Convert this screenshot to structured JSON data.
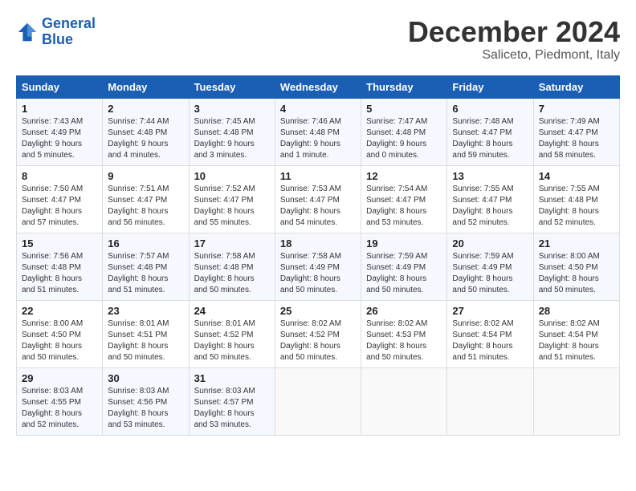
{
  "logo": {
    "line1": "General",
    "line2": "Blue"
  },
  "title": "December 2024",
  "subtitle": "Saliceto, Piedmont, Italy",
  "weekdays": [
    "Sunday",
    "Monday",
    "Tuesday",
    "Wednesday",
    "Thursday",
    "Friday",
    "Saturday"
  ],
  "weeks": [
    [
      {
        "day": "1",
        "info": "Sunrise: 7:43 AM\nSunset: 4:49 PM\nDaylight: 9 hours\nand 5 minutes."
      },
      {
        "day": "2",
        "info": "Sunrise: 7:44 AM\nSunset: 4:48 PM\nDaylight: 9 hours\nand 4 minutes."
      },
      {
        "day": "3",
        "info": "Sunrise: 7:45 AM\nSunset: 4:48 PM\nDaylight: 9 hours\nand 3 minutes."
      },
      {
        "day": "4",
        "info": "Sunrise: 7:46 AM\nSunset: 4:48 PM\nDaylight: 9 hours\nand 1 minute."
      },
      {
        "day": "5",
        "info": "Sunrise: 7:47 AM\nSunset: 4:48 PM\nDaylight: 9 hours\nand 0 minutes."
      },
      {
        "day": "6",
        "info": "Sunrise: 7:48 AM\nSunset: 4:47 PM\nDaylight: 8 hours\nand 59 minutes."
      },
      {
        "day": "7",
        "info": "Sunrise: 7:49 AM\nSunset: 4:47 PM\nDaylight: 8 hours\nand 58 minutes."
      }
    ],
    [
      {
        "day": "8",
        "info": "Sunrise: 7:50 AM\nSunset: 4:47 PM\nDaylight: 8 hours\nand 57 minutes."
      },
      {
        "day": "9",
        "info": "Sunrise: 7:51 AM\nSunset: 4:47 PM\nDaylight: 8 hours\nand 56 minutes."
      },
      {
        "day": "10",
        "info": "Sunrise: 7:52 AM\nSunset: 4:47 PM\nDaylight: 8 hours\nand 55 minutes."
      },
      {
        "day": "11",
        "info": "Sunrise: 7:53 AM\nSunset: 4:47 PM\nDaylight: 8 hours\nand 54 minutes."
      },
      {
        "day": "12",
        "info": "Sunrise: 7:54 AM\nSunset: 4:47 PM\nDaylight: 8 hours\nand 53 minutes."
      },
      {
        "day": "13",
        "info": "Sunrise: 7:55 AM\nSunset: 4:47 PM\nDaylight: 8 hours\nand 52 minutes."
      },
      {
        "day": "14",
        "info": "Sunrise: 7:55 AM\nSunset: 4:48 PM\nDaylight: 8 hours\nand 52 minutes."
      }
    ],
    [
      {
        "day": "15",
        "info": "Sunrise: 7:56 AM\nSunset: 4:48 PM\nDaylight: 8 hours\nand 51 minutes."
      },
      {
        "day": "16",
        "info": "Sunrise: 7:57 AM\nSunset: 4:48 PM\nDaylight: 8 hours\nand 51 minutes."
      },
      {
        "day": "17",
        "info": "Sunrise: 7:58 AM\nSunset: 4:48 PM\nDaylight: 8 hours\nand 50 minutes."
      },
      {
        "day": "18",
        "info": "Sunrise: 7:58 AM\nSunset: 4:49 PM\nDaylight: 8 hours\nand 50 minutes."
      },
      {
        "day": "19",
        "info": "Sunrise: 7:59 AM\nSunset: 4:49 PM\nDaylight: 8 hours\nand 50 minutes."
      },
      {
        "day": "20",
        "info": "Sunrise: 7:59 AM\nSunset: 4:49 PM\nDaylight: 8 hours\nand 50 minutes."
      },
      {
        "day": "21",
        "info": "Sunrise: 8:00 AM\nSunset: 4:50 PM\nDaylight: 8 hours\nand 50 minutes."
      }
    ],
    [
      {
        "day": "22",
        "info": "Sunrise: 8:00 AM\nSunset: 4:50 PM\nDaylight: 8 hours\nand 50 minutes."
      },
      {
        "day": "23",
        "info": "Sunrise: 8:01 AM\nSunset: 4:51 PM\nDaylight: 8 hours\nand 50 minutes."
      },
      {
        "day": "24",
        "info": "Sunrise: 8:01 AM\nSunset: 4:52 PM\nDaylight: 8 hours\nand 50 minutes."
      },
      {
        "day": "25",
        "info": "Sunrise: 8:02 AM\nSunset: 4:52 PM\nDaylight: 8 hours\nand 50 minutes."
      },
      {
        "day": "26",
        "info": "Sunrise: 8:02 AM\nSunset: 4:53 PM\nDaylight: 8 hours\nand 50 minutes."
      },
      {
        "day": "27",
        "info": "Sunrise: 8:02 AM\nSunset: 4:54 PM\nDaylight: 8 hours\nand 51 minutes."
      },
      {
        "day": "28",
        "info": "Sunrise: 8:02 AM\nSunset: 4:54 PM\nDaylight: 8 hours\nand 51 minutes."
      }
    ],
    [
      {
        "day": "29",
        "info": "Sunrise: 8:03 AM\nSunset: 4:55 PM\nDaylight: 8 hours\nand 52 minutes."
      },
      {
        "day": "30",
        "info": "Sunrise: 8:03 AM\nSunset: 4:56 PM\nDaylight: 8 hours\nand 53 minutes."
      },
      {
        "day": "31",
        "info": "Sunrise: 8:03 AM\nSunset: 4:57 PM\nDaylight: 8 hours\nand 53 minutes."
      },
      {
        "day": "",
        "info": ""
      },
      {
        "day": "",
        "info": ""
      },
      {
        "day": "",
        "info": ""
      },
      {
        "day": "",
        "info": ""
      }
    ]
  ]
}
